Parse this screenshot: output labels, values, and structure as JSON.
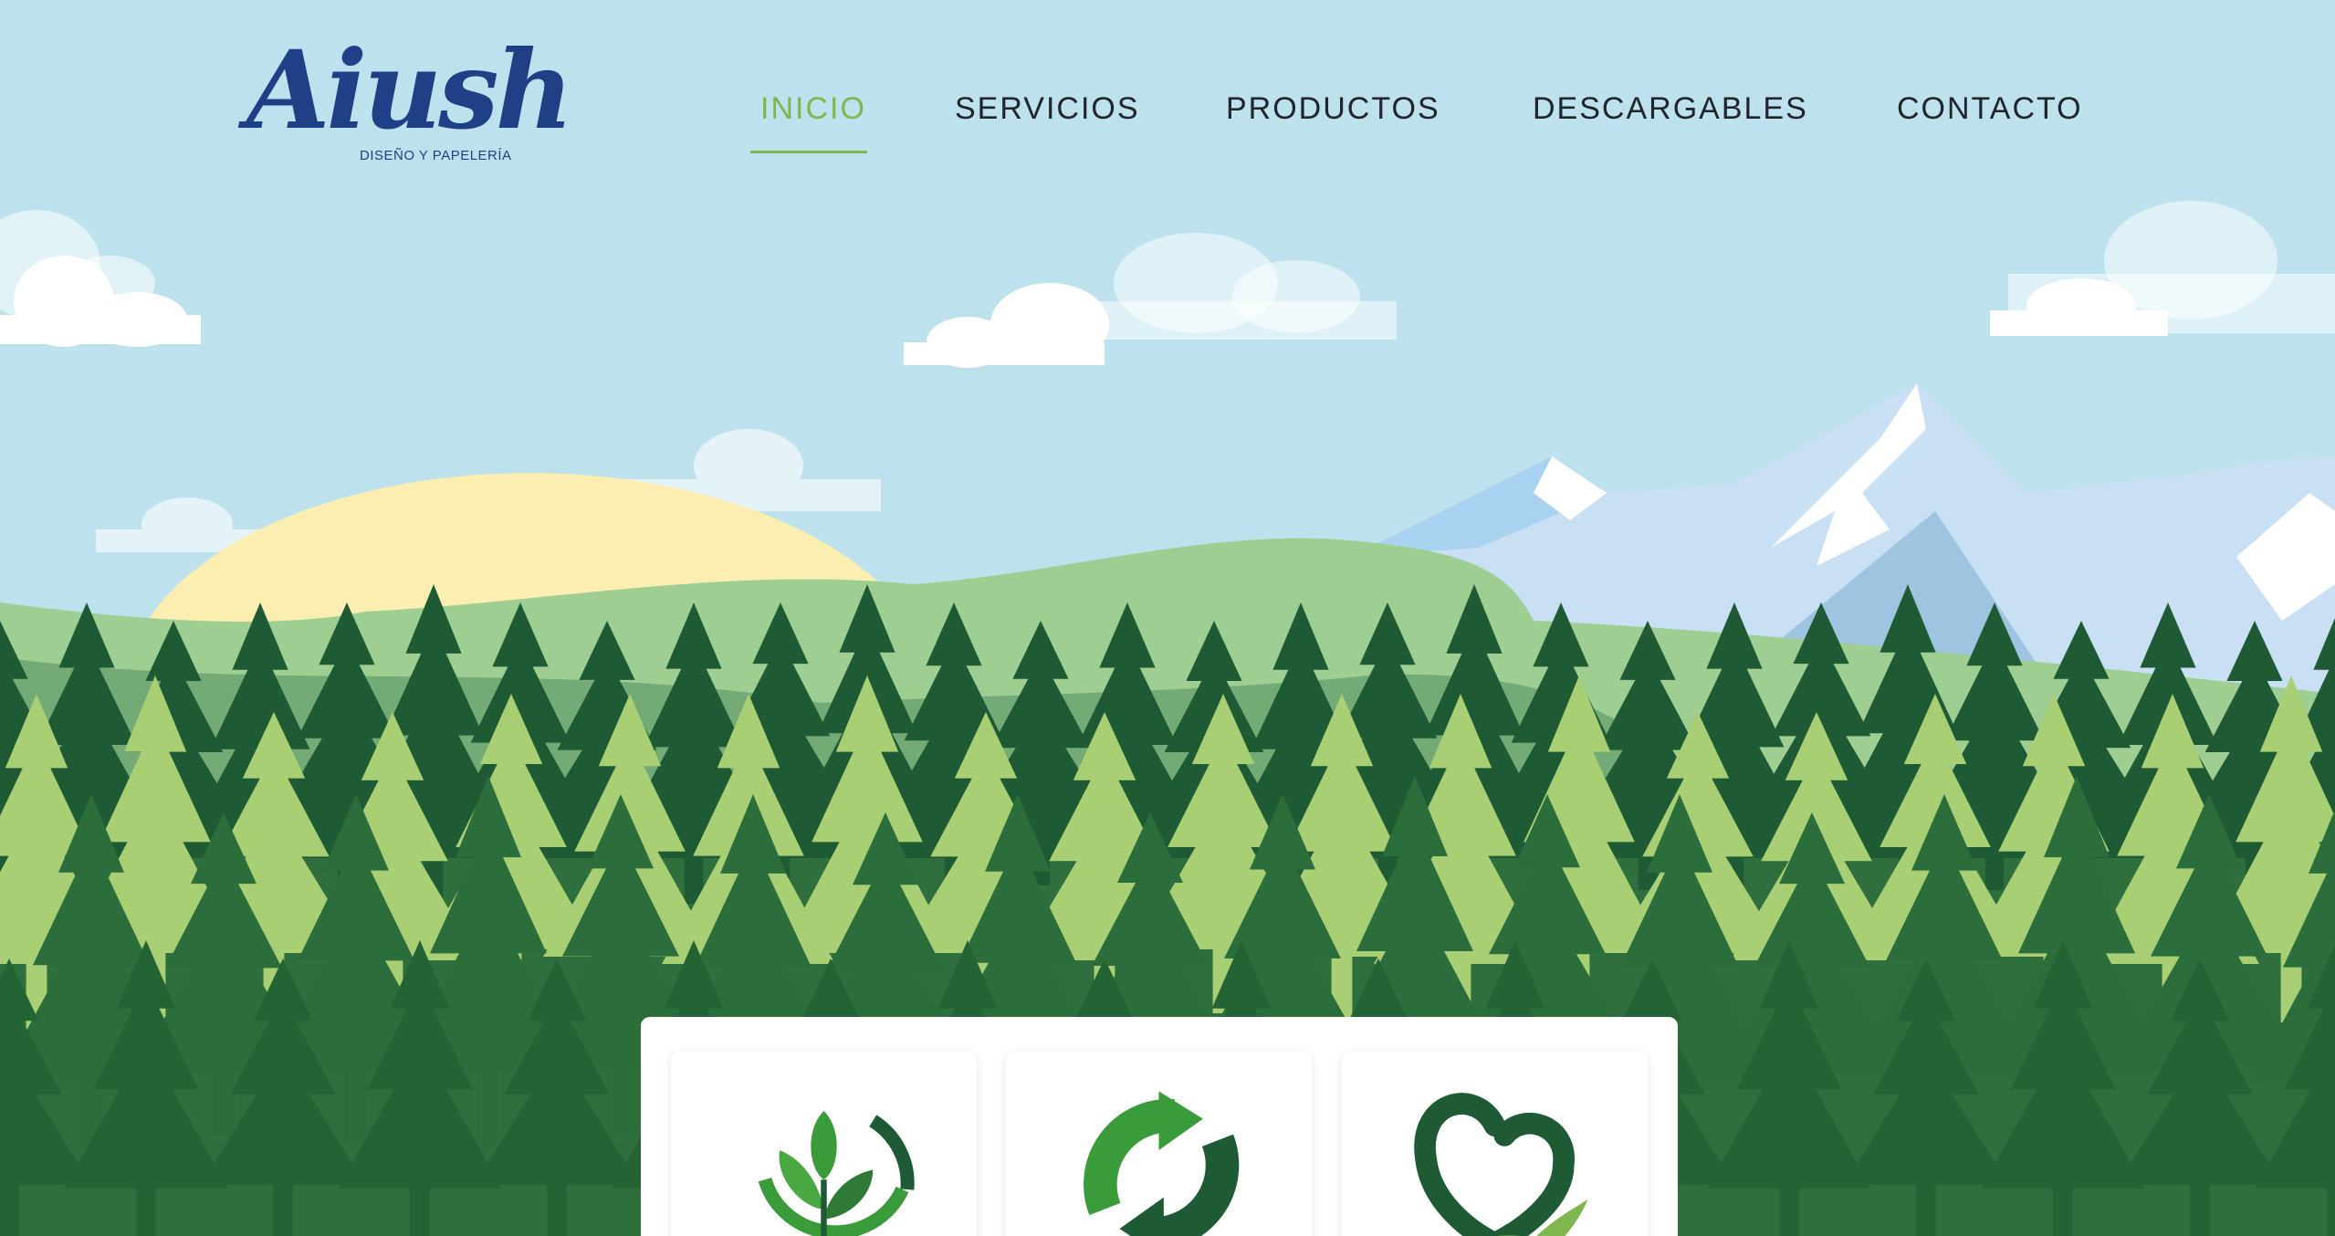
{
  "brand": {
    "name": "Aiush",
    "tagline": "DISEÑO Y PAPELERÍA",
    "color": "#1f3f86"
  },
  "nav": {
    "active_color": "#7fb74e",
    "items": [
      {
        "label": "INICIO",
        "active": true
      },
      {
        "label": "SERVICIOS",
        "active": false
      },
      {
        "label": "PRODUCTOS",
        "active": false
      },
      {
        "label": "DESCARGABLES",
        "active": false
      },
      {
        "label": "CONTACTO",
        "active": false
      }
    ]
  },
  "hero": {
    "sky_color": "#bde2ee",
    "sun_color": "#fbeeb0"
  },
  "cards": [
    {
      "icon": "leaves-icon"
    },
    {
      "icon": "recycle-icon"
    },
    {
      "icon": "heart-hand-icon"
    }
  ]
}
